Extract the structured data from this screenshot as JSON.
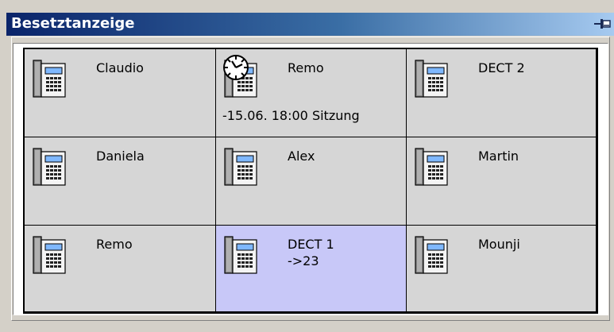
{
  "window": {
    "title": "Besetztanzeige",
    "pin_icon": "pin-icon"
  },
  "colors": {
    "title_start": "#0a246a",
    "title_end": "#a6caf0",
    "cell_bg": "#d6d6d6",
    "active_cell_bg": "#c8c8f8"
  },
  "cells": [
    {
      "name": "Claudio",
      "sub": "",
      "note": "",
      "icon": "desk-phone-icon",
      "clock": false,
      "active": false
    },
    {
      "name": "Remo",
      "sub": "",
      "note": "-15.06. 18:00 Sitzung",
      "icon": "desk-phone-icon",
      "clock": true,
      "active": false
    },
    {
      "name": "DECT 2",
      "sub": "",
      "note": "",
      "icon": "desk-phone-icon",
      "clock": false,
      "active": false
    },
    {
      "name": "Daniela",
      "sub": "",
      "note": "",
      "icon": "desk-phone-icon",
      "clock": false,
      "active": false
    },
    {
      "name": "Alex",
      "sub": "",
      "note": "",
      "icon": "desk-phone-icon",
      "clock": false,
      "active": false
    },
    {
      "name": "Martin",
      "sub": "",
      "note": "",
      "icon": "desk-phone-icon",
      "clock": false,
      "active": false
    },
    {
      "name": "Remo",
      "sub": "",
      "note": "",
      "icon": "desk-phone-icon",
      "clock": false,
      "active": false
    },
    {
      "name": "DECT 1",
      "sub": "->23",
      "note": "",
      "icon": "desk-phone-icon",
      "clock": false,
      "active": true
    },
    {
      "name": "Mounji",
      "sub": "",
      "note": "",
      "icon": "desk-phone-icon",
      "clock": false,
      "active": false
    }
  ]
}
